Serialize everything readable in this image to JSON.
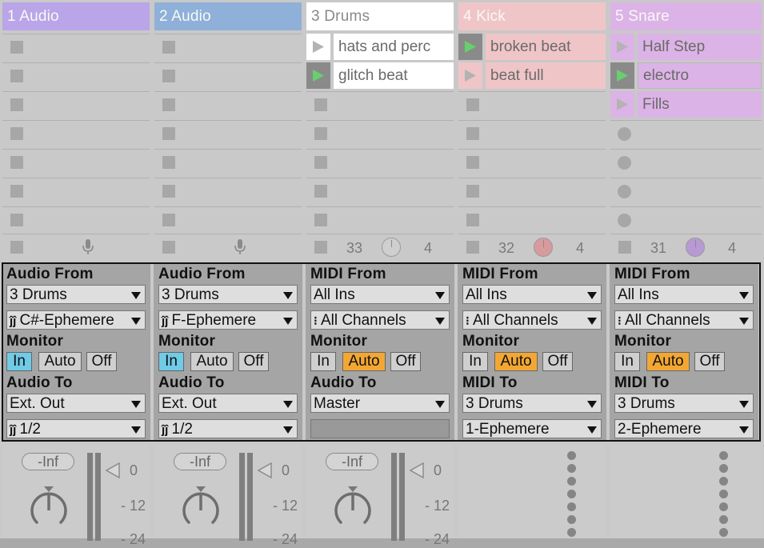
{
  "tracks": [
    {
      "name": "1 Audio",
      "header_color": "#b9a5e8",
      "clips": [
        null,
        null,
        null,
        null,
        null,
        null,
        null
      ],
      "slot_style": "square",
      "status": {
        "type": "mic"
      },
      "io": {
        "from_label": "Audio From",
        "from_value": "3 Drums",
        "channel_value": "C#-Ephemere",
        "monitor_label": "Monitor",
        "monitor": [
          "In",
          "Auto",
          "Off"
        ],
        "monitor_active": "In",
        "to_label": "Audio To",
        "to_value": "Ext. Out",
        "to_channel": "1/2"
      },
      "mixer": {
        "volume": "-Inf",
        "ticks": [
          "0",
          "12",
          "24"
        ]
      }
    },
    {
      "name": "2 Audio",
      "header_color": "#8fb0d8",
      "clips": [
        null,
        null,
        null,
        null,
        null,
        null,
        null
      ],
      "slot_style": "square",
      "status": {
        "type": "mic"
      },
      "io": {
        "from_label": "Audio From",
        "from_value": "3 Drums",
        "channel_value": "F-Ephemere",
        "monitor_label": "Monitor",
        "monitor": [
          "In",
          "Auto",
          "Off"
        ],
        "monitor_active": "In",
        "to_label": "Audio To",
        "to_value": "Ext. Out",
        "to_channel": "1/2"
      },
      "mixer": {
        "volume": "-Inf",
        "ticks": [
          "0",
          "12",
          "24"
        ]
      }
    },
    {
      "name": "3 Drums",
      "header_color": "#ffffff",
      "clips": [
        {
          "name": "hats and perc",
          "playing": false,
          "color": "#ffffff"
        },
        {
          "name": "glitch beat",
          "playing": true,
          "color": "#ffffff"
        },
        null,
        null,
        null,
        null,
        null
      ],
      "slot_style": "square",
      "status": {
        "type": "knob",
        "left": "33",
        "right": "4",
        "knob_color": "#cfcfcf"
      },
      "io": {
        "from_label": "MIDI From",
        "from_value": "All Ins",
        "channel_value": "All Channels",
        "monitor_label": "Monitor",
        "monitor": [
          "In",
          "Auto",
          "Off"
        ],
        "monitor_active": "Auto",
        "to_label": "Audio To",
        "to_value": "Master",
        "to_channel": ""
      },
      "mixer": {
        "volume": "-Inf",
        "ticks": [
          "0",
          "12",
          "24"
        ]
      }
    },
    {
      "name": "4 Kick",
      "header_color": "#f0c5c8",
      "clips": [
        {
          "name": "broken beat",
          "playing": true,
          "color": "#f0c5c8"
        },
        {
          "name": "beat full",
          "playing": false,
          "color": "#f0c5c8"
        },
        null,
        null,
        null,
        null,
        null
      ],
      "slot_style": "square",
      "status": {
        "type": "knob",
        "left": "32",
        "right": "4",
        "knob_color": "#d99a9e"
      },
      "io": {
        "from_label": "MIDI From",
        "from_value": "All Ins",
        "channel_value": "All Channels",
        "monitor_label": "Monitor",
        "monitor": [
          "In",
          "Auto",
          "Off"
        ],
        "monitor_active": "Auto",
        "to_label": "MIDI To",
        "to_value": "3 Drums",
        "to_channel": "1-Ephemere"
      },
      "mixer": null
    },
    {
      "name": "5 Snare",
      "header_color": "#dcb3e6",
      "clips": [
        {
          "name": "Half Step",
          "playing": false,
          "color": "#dcb3e6"
        },
        {
          "name": "electro",
          "playing": true,
          "color": "#dcb3e6"
        },
        {
          "name": "Fills",
          "playing": false,
          "color": "#dcb3e6"
        },
        null,
        null,
        null,
        null
      ],
      "slot_style": "circle",
      "status": {
        "type": "knob",
        "left": "31",
        "right": "4",
        "knob_color": "#b79ad3"
      },
      "io": {
        "from_label": "MIDI From",
        "from_value": "All Ins",
        "channel_value": "All Channels",
        "monitor_label": "Monitor",
        "monitor": [
          "In",
          "Auto",
          "Off"
        ],
        "monitor_active": "Auto",
        "to_label": "MIDI To",
        "to_value": "3 Drums",
        "to_channel": "2-Ephemere"
      },
      "mixer": null
    }
  ]
}
